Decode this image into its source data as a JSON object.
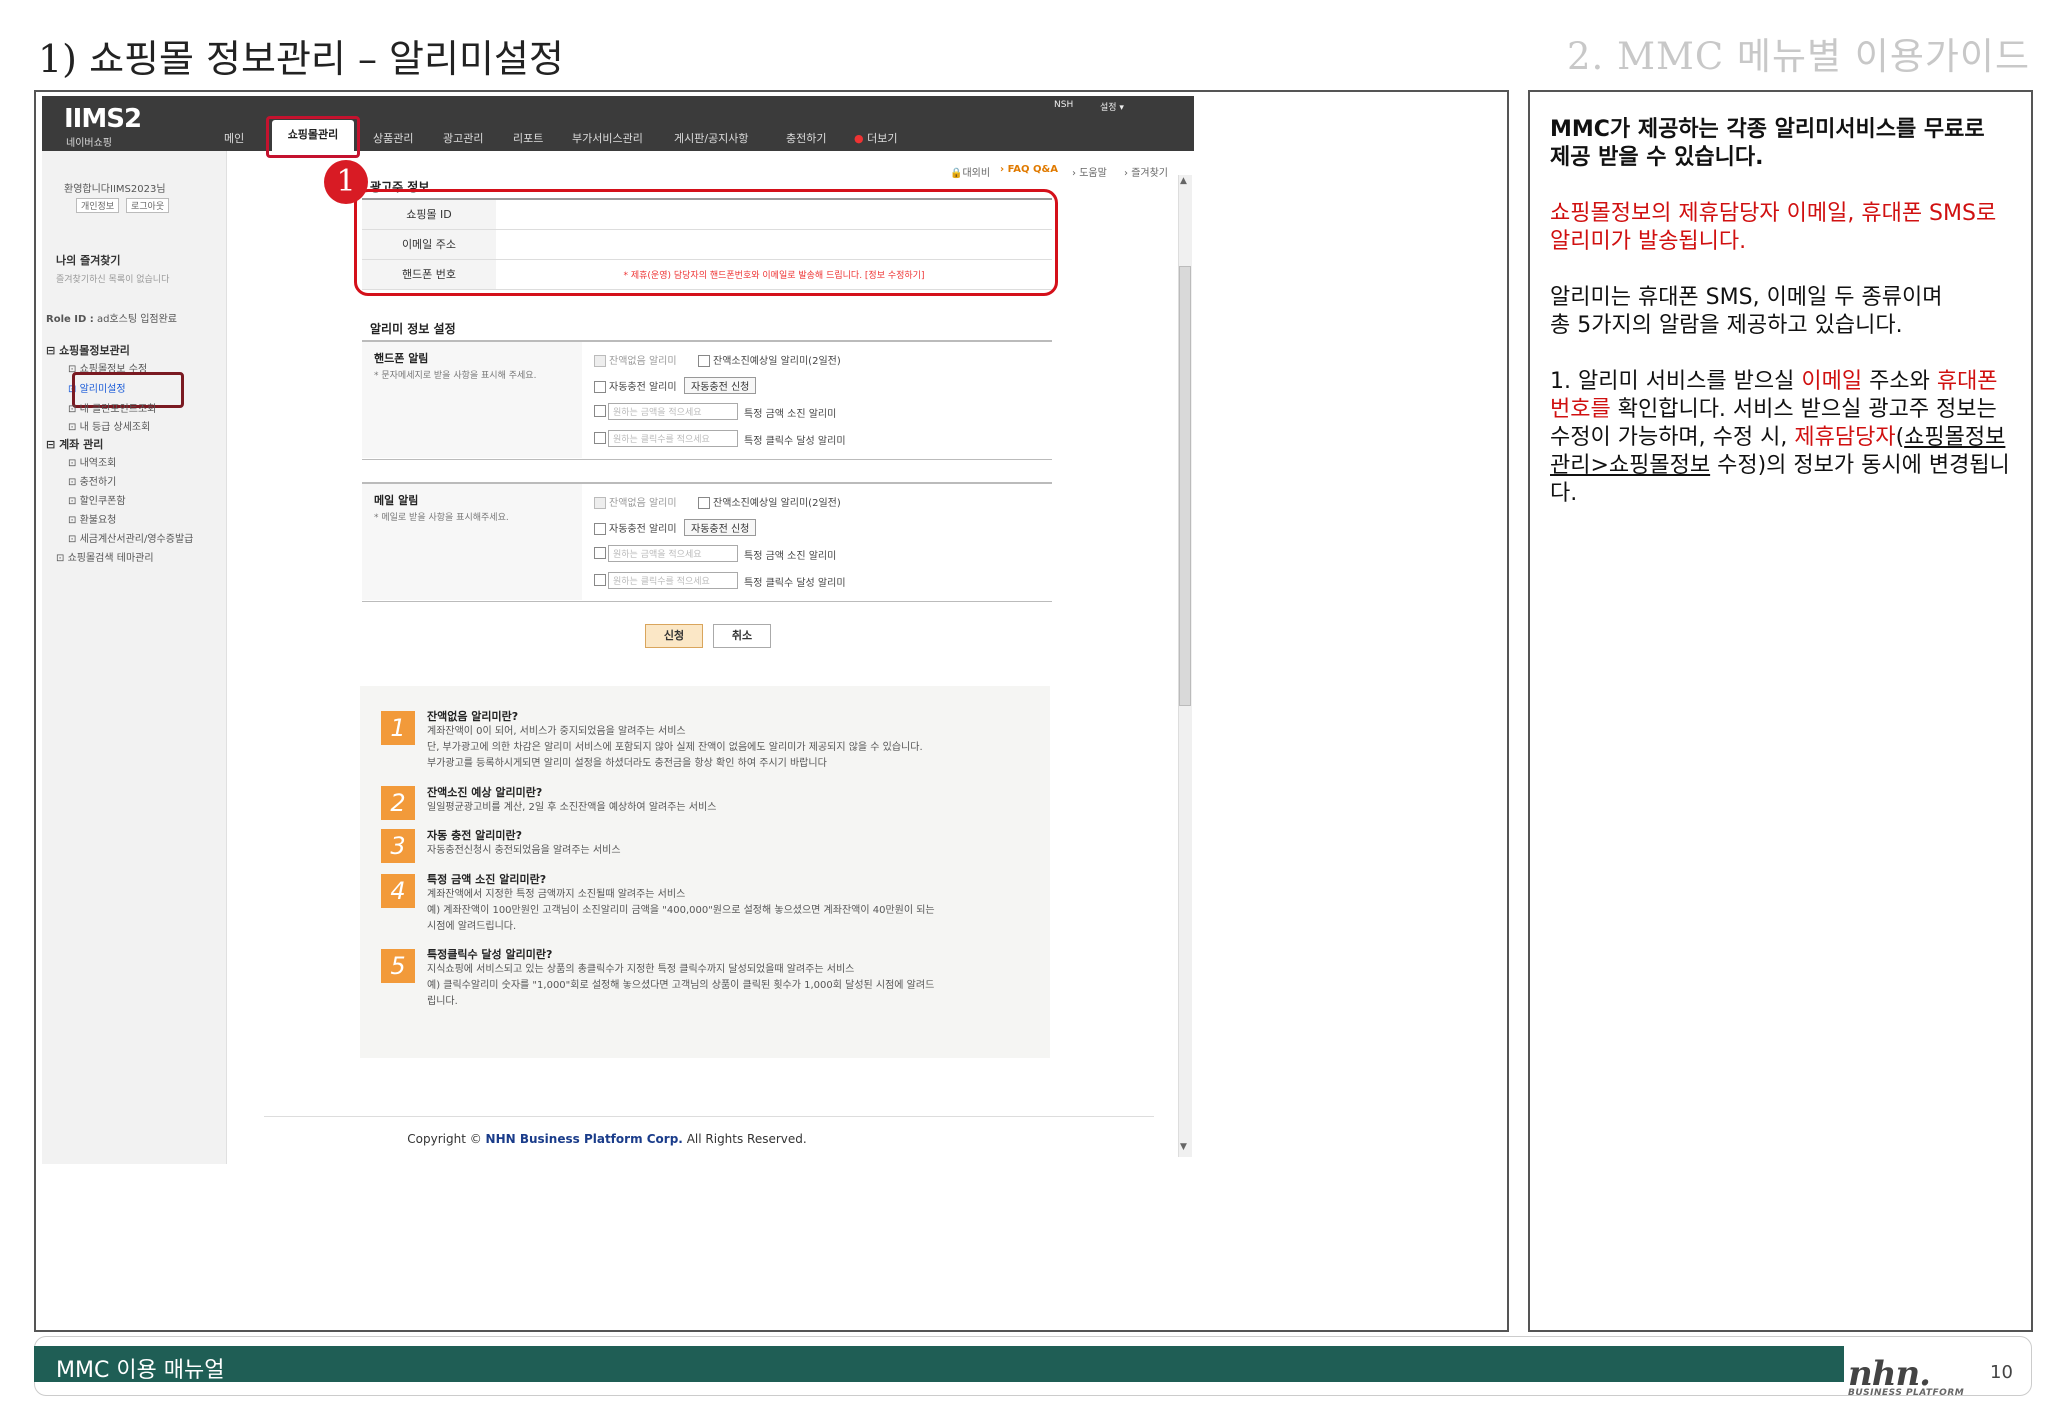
{
  "slide": {
    "title": "1) 쇼핑몰 정보관리 – 알리미설정",
    "section": "2. MMC 메뉴별 이용가이드",
    "page_number": "10",
    "footer_title": "MMC 이용 매뉴얼",
    "footer_logo": "nhn.",
    "footer_logo_sub": "BUSINESS PLATFORM"
  },
  "app": {
    "logo": "IIMS2",
    "logo_sub": "네이버쇼핑",
    "util_links": [
      "NSH",
      "설정 ▾"
    ],
    "nav": {
      "items": [
        "메인",
        "쇼핑몰관리",
        "상품관리",
        "광고관리",
        "리포트",
        "부가서비스관리",
        "게시판/공지사항",
        "충전하기",
        "더보기"
      ],
      "active": "쇼핑몰관리"
    },
    "top_links": [
      "대외비",
      "FAQ Q&A",
      "도움말",
      "즐겨찾기"
    ],
    "sidebar": {
      "welcome": "환영합니다IIMS2023님",
      "buttons": [
        "개인정보",
        "로그아웃"
      ],
      "favorites_title": "나의 즐겨찾기",
      "favorites_empty": "즐겨찾기하신 목록이 없습니다",
      "role_label": "Role ID :",
      "role_value": "ad호스팅 입점완료",
      "tree": [
        {
          "label": "쇼핑몰정보관리",
          "level": 0
        },
        {
          "label": "쇼핑몰정보 수정",
          "level": 1
        },
        {
          "label": "알리미설정",
          "level": 1,
          "selected": true
        },
        {
          "label": "내 클린포인트조회",
          "level": 1
        },
        {
          "label": "내 등급 상세조회",
          "level": 1
        },
        {
          "label": "계좌 관리",
          "level": 0
        },
        {
          "label": "내역조회",
          "level": 1
        },
        {
          "label": "충전하기",
          "level": 1
        },
        {
          "label": "할인쿠폰함",
          "level": 1
        },
        {
          "label": "환불요청",
          "level": 1
        },
        {
          "label": "세금계산서관리/영수증발급",
          "level": 1
        },
        {
          "label": "쇼핑몰검색 테마관리",
          "level": 0
        }
      ]
    },
    "advertiser_info": {
      "title": "광고주 정보",
      "rows": [
        {
          "label": "쇼핑몰 ID",
          "value": ""
        },
        {
          "label": "이메일 주소",
          "value": ""
        },
        {
          "label": "핸드폰 번호",
          "value": "* 제휴(운영) 담당자의 핸드폰번호와 이메일로 발송해 드립니다. [정보 수정하기]"
        }
      ],
      "badge": "1"
    },
    "alarm_settings": {
      "title": "알리미 정보 설정",
      "sections": [
        {
          "name": "핸드폰 알림",
          "desc": "* 문자메세지로 받을 사항을 표시해 주세요.",
          "opts": {
            "no_balance": "잔액없음 알리미",
            "expected": "잔액소진예상일 알리미(2일전)",
            "auto_charge": "자동충전 알리미",
            "auto_charge_btn": "자동충전 신청",
            "amount_placeholder": "원하는 금액을 적으세요",
            "amount_label": "특정 금액 소진 알리미",
            "clicks_placeholder": "원하는 클릭수를 적으세요",
            "clicks_label": "특정 클릭수 달성 알리미"
          }
        },
        {
          "name": "메일 알림",
          "desc": "* 메일로 받을 사항을 표시해주세요.",
          "opts": {
            "no_balance": "잔액없음 알리미",
            "expected": "잔액소진예상일 알리미(2일전)",
            "auto_charge": "자동충전 알리미",
            "auto_charge_btn": "자동충전 신청",
            "amount_placeholder": "원하는 금액을 적으세요",
            "amount_label": "특정 금액 소진 알리미",
            "clicks_placeholder": "원하는 클릭수를 적으세요",
            "clicks_label": "특정 클릭수 달성 알리미"
          }
        }
      ],
      "submit": "신청",
      "cancel": "취소"
    },
    "faq": [
      {
        "num": "1",
        "q": "잔액없음 알리미란?",
        "a": [
          "계좌잔액이 0이 되어, 서비스가 중지되었음을 알려주는 서비스",
          "단, 부가광고에 의한 차감은 알리미 서비스에 포함되지 않아 실제 잔액이 없음에도 알리미가 제공되지 않을 수 있습니다.",
          "부가광고를 등록하시게되면 알리미 설정을 하셨더라도 충전금을 항상 확인 하여 주시기 바랍니다"
        ]
      },
      {
        "num": "2",
        "q": "잔액소진 예상 알리미란?",
        "a": [
          "일일평균광고비를 계산, 2일 후 소진잔액을 예상하여 알려주는 서비스"
        ]
      },
      {
        "num": "3",
        "q": "자동 충전 알리미란?",
        "a": [
          "자동충전신청시 충전되었음을 알려주는 서비스"
        ]
      },
      {
        "num": "4",
        "q": "특정 금액 소진 알리미란?",
        "a": [
          "계좌잔액에서 지정한 특정 금액까지 소진될때 알려주는 서비스",
          "예) 계좌잔액이 100만원인 고객님이 소진알리미 금액을 \"400,000\"원으로 설정해 놓으셨으면 계좌잔액이 40만원이 되는",
          "시점에 알려드립니다."
        ]
      },
      {
        "num": "5",
        "q": "특정클릭수 달성 알리미란?",
        "a": [
          "지식쇼핑에 서비스되고 있는 상품의 총클릭수가 지정한 특정 클릭수까지 달성되었을때 알려주는 서비스",
          "예) 클릭수알리미 숫자를 \"1,000\"회로 설정해 놓으셨다면 고객님의 상품이 클릭된 횟수가 1,000회 달성된 시점에 알려드",
          "립니다."
        ]
      }
    ],
    "copyright_pre": "Copyright ©",
    "copyright_corp": "NHN Business Platform Corp.",
    "copyright_post": "All Rights Reserved."
  },
  "description": {
    "p1": "MMC가 제공하는 각종 알리미서비스를 무료로 제공 받을 수 있습니다.",
    "p2": "쇼핑몰정보의 제휴담당자 이메일, 휴대폰 SMS로 알리미가 발송됩니다.",
    "p3a": "알리미는 휴대폰 SMS, 이메일 두 종류이며",
    "p3b": "총 5가지의 알람을 제공하고 있습니다.",
    "p4_1": "1. 알리미 서비스를 받으실 ",
    "p4_2": "이메일",
    "p4_3": " 주소와",
    "p4_4": "휴대폰번호를",
    "p4_5": " 확인합니다.",
    "p4_6": "서비스 받으실 광고주 정보는 수정이 가능하며, 수정 시, ",
    "p4_7": "제휴담당자",
    "p4_8": "(",
    "p4_9": "쇼핑몰정보관리>쇼핑몰정보",
    "p4_10": " 수정)의 정보가 동시에 변경됩니다."
  },
  "colors": {
    "highlight_red": "#d4101a",
    "footer_green": "#1f5e55",
    "faq_number_orange": "#f29a3a",
    "topbar_dark": "#3b3b3b"
  }
}
